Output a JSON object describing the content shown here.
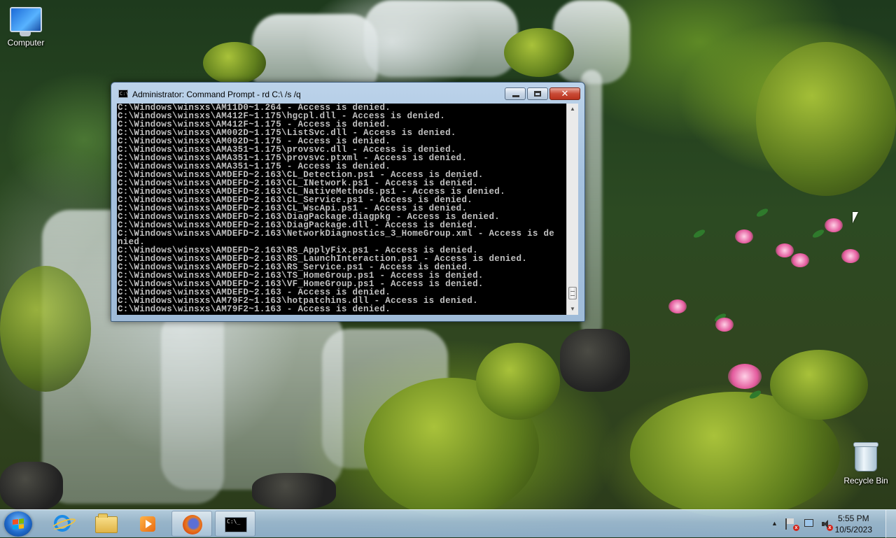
{
  "desktop": {
    "icons": [
      {
        "label": "Computer",
        "icon": "computer-icon"
      },
      {
        "label": "Recycle Bin",
        "icon": "recycle-bin-icon"
      }
    ]
  },
  "window": {
    "title": "Administrator:  Command Prompt - rd  C:\\ /s /q",
    "buttons": {
      "minimize": "minimize",
      "maximize": "maximize",
      "close": "✕"
    },
    "console_lines": [
      "C:\\Windows\\winsxs\\AM11D0~1.264 - Access is denied.",
      "C:\\Windows\\winsxs\\AM412F~1.175\\hgcpl.dll - Access is denied.",
      "C:\\Windows\\winsxs\\AM412F~1.175 - Access is denied.",
      "C:\\Windows\\winsxs\\AM002D~1.175\\ListSvc.dll - Access is denied.",
      "C:\\Windows\\winsxs\\AM002D~1.175 - Access is denied.",
      "C:\\Windows\\winsxs\\AMA351~1.175\\provsvc.dll - Access is denied.",
      "C:\\Windows\\winsxs\\AMA351~1.175\\provsvc.ptxml - Access is denied.",
      "C:\\Windows\\winsxs\\AMA351~1.175 - Access is denied.",
      "C:\\Windows\\winsxs\\AMDEFD~2.163\\CL_Detection.ps1 - Access is denied.",
      "C:\\Windows\\winsxs\\AMDEFD~2.163\\CL_INetwork.ps1 - Access is denied.",
      "C:\\Windows\\winsxs\\AMDEFD~2.163\\CL_NativeMethods.ps1 - Access is denied.",
      "C:\\Windows\\winsxs\\AMDEFD~2.163\\CL_Service.ps1 - Access is denied.",
      "C:\\Windows\\winsxs\\AMDEFD~2.163\\CL_WscApi.ps1 - Access is denied.",
      "C:\\Windows\\winsxs\\AMDEFD~2.163\\DiagPackage.diagpkg - Access is denied.",
      "C:\\Windows\\winsxs\\AMDEFD~2.163\\DiagPackage.dll - Access is denied.",
      "C:\\Windows\\winsxs\\AMDEFD~2.163\\NetworkDiagnostics_3_HomeGroup.xml - Access is de",
      "nied.",
      "C:\\Windows\\winsxs\\AMDEFD~2.163\\RS_ApplyFix.ps1 - Access is denied.",
      "C:\\Windows\\winsxs\\AMDEFD~2.163\\RS_LaunchInteraction.ps1 - Access is denied.",
      "C:\\Windows\\winsxs\\AMDEFD~2.163\\RS_Service.ps1 - Access is denied.",
      "C:\\Windows\\winsxs\\AMDEFD~2.163\\TS_HomeGroup.ps1 - Access is denied.",
      "C:\\Windows\\winsxs\\AMDEFD~2.163\\VF_HomeGroup.ps1 - Access is denied.",
      "C:\\Windows\\winsxs\\AMDEFD~2.163 - Access is denied.",
      "C:\\Windows\\winsxs\\AM79F2~1.163\\hotpatchins.dll - Access is denied.",
      "C:\\Windows\\winsxs\\AM79F2~1.163 - Access is denied."
    ]
  },
  "taskbar": {
    "items": [
      {
        "name": "start",
        "icon": "windows-logo-icon"
      },
      {
        "name": "internet-explorer",
        "icon": "internet-explorer-icon"
      },
      {
        "name": "windows-explorer",
        "icon": "folder-icon"
      },
      {
        "name": "windows-media-player",
        "icon": "media-player-icon"
      },
      {
        "name": "firefox",
        "icon": "firefox-icon"
      },
      {
        "name": "command-prompt",
        "icon": "command-prompt-icon",
        "active": true
      }
    ],
    "tray": {
      "icons": [
        "show-hidden-icons-arrow",
        "action-center-flag-icon",
        "network-icon",
        "volume-muted-icon"
      ],
      "time": "5:55 PM",
      "date": "10/5/2023"
    }
  }
}
